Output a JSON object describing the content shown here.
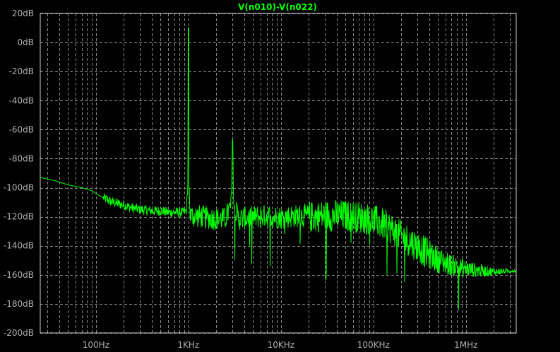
{
  "chart_data": {
    "type": "line",
    "title": "V(n010)-V(n022)",
    "xlabel": "",
    "ylabel": "",
    "x_scale": "log",
    "xlim": [
      25,
      3500000
    ],
    "ylim": [
      -200,
      20
    ],
    "grid": true,
    "y_ticks": [
      {
        "value": 20,
        "label": "20dB"
      },
      {
        "value": 0,
        "label": "0dB"
      },
      {
        "value": -20,
        "label": "-20dB"
      },
      {
        "value": -40,
        "label": "-40dB"
      },
      {
        "value": -60,
        "label": "-60dB"
      },
      {
        "value": -80,
        "label": "-80dB"
      },
      {
        "value": -100,
        "label": "-100dB"
      },
      {
        "value": -120,
        "label": "-120dB"
      },
      {
        "value": -140,
        "label": "-140dB"
      },
      {
        "value": -160,
        "label": "-160dB"
      },
      {
        "value": -180,
        "label": "-180dB"
      },
      {
        "value": -200,
        "label": "-200dB"
      }
    ],
    "x_ticks": [
      {
        "value": 100,
        "label": "100Hz"
      },
      {
        "value": 1000,
        "label": "1KHz"
      },
      {
        "value": 10000,
        "label": "10KHz"
      },
      {
        "value": 100000,
        "label": "100KHz"
      },
      {
        "value": 1000000,
        "label": "1MHz"
      }
    ],
    "series": [
      {
        "color": "#00ff00",
        "x": [
          25,
          35,
          50,
          70,
          90,
          100,
          120,
          150,
          200,
          250,
          300,
          400,
          500,
          600,
          700,
          800,
          900,
          950,
          990,
          1000,
          1010,
          1050,
          1200,
          1500,
          2000,
          2500,
          2900,
          3000,
          3100,
          3500,
          5000,
          7000,
          10000,
          15000,
          20000,
          30000,
          40000,
          50000,
          70000,
          100000,
          150000,
          200000,
          300000,
          400000,
          500000,
          700000,
          1000000,
          1500000,
          2000000,
          3500000
        ],
        "y": [
          -93,
          -95,
          -98,
          -100,
          -102,
          -104,
          -107,
          -110,
          -112,
          -114,
          -115,
          -116,
          -116,
          -117,
          -117,
          -117,
          -117,
          -116,
          -95,
          10,
          -95,
          -117,
          -117,
          -118,
          -119,
          -119,
          -110,
          -67,
          -110,
          -119,
          -118,
          -117,
          -118,
          -117,
          -117,
          -116,
          -116,
          -116,
          -117,
          -119,
          -124,
          -130,
          -137,
          -143,
          -147,
          -151,
          -154,
          -156,
          -157,
          -157
        ]
      }
    ]
  }
}
